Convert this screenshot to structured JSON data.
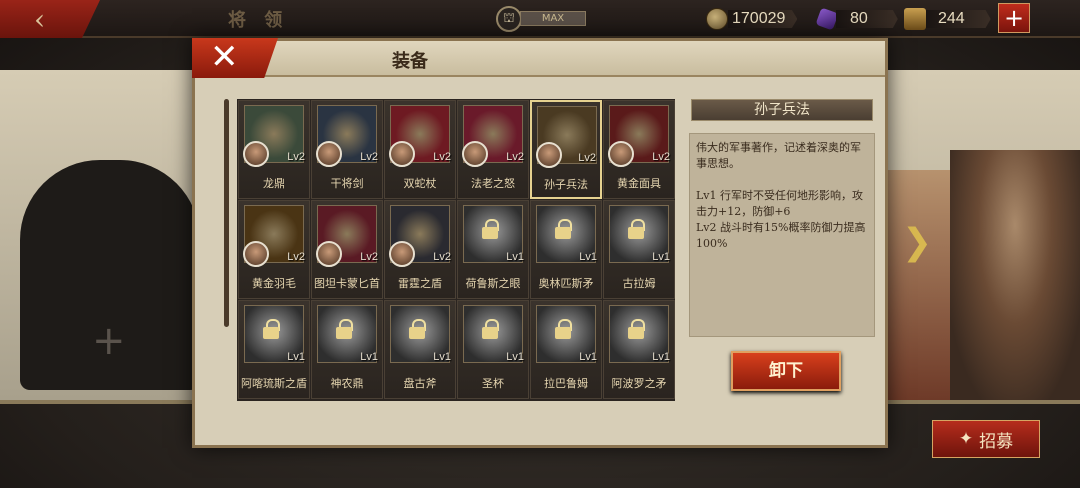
{
  "topbar": {
    "title": "将 领",
    "level_label": "MAX",
    "coins": "170029",
    "gems": "80",
    "chests": "244",
    "plus": "+"
  },
  "recruit_label": "招募",
  "modal": {
    "title": "装备",
    "selected": {
      "name": "孙子兵法",
      "description": "伟大的军事著作，记述着深奥的军事思想。",
      "effect_lv1": "Lv1  行军时不受任何地形影响，攻击力+12，防御+6",
      "effect_lv2": "Lv2  战斗时有15%概率防御力提高100%"
    },
    "unequip_label": "卸下",
    "items": [
      {
        "name": "龙鼎",
        "level": "Lv2",
        "locked": false,
        "color": "#3b4a3a"
      },
      {
        "name": "干将剑",
        "level": "Lv2",
        "locked": false,
        "color": "#2a3442"
      },
      {
        "name": "双蛇杖",
        "level": "Lv2",
        "locked": false,
        "color": "#6e1a22"
      },
      {
        "name": "法老之怒",
        "level": "Lv2",
        "locked": false,
        "color": "#6a1a2a"
      },
      {
        "name": "孙子兵法",
        "level": "Lv2",
        "locked": false,
        "color": "#4a3a22"
      },
      {
        "name": "黄金面具",
        "level": "Lv2",
        "locked": false,
        "color": "#5a1a1a"
      },
      {
        "name": "黄金羽毛",
        "level": "Lv2",
        "locked": false,
        "color": "#4a3414"
      },
      {
        "name": "图坦卡蒙匕首",
        "level": "Lv2",
        "locked": false,
        "color": "#5a1a24"
      },
      {
        "name": "雷霆之盾",
        "level": "Lv2",
        "locked": false,
        "color": "#2a2a30"
      },
      {
        "name": "荷鲁斯之眼",
        "level": "Lv1",
        "locked": true,
        "color": "#555"
      },
      {
        "name": "奥林匹斯矛",
        "level": "Lv1",
        "locked": true,
        "color": "#555"
      },
      {
        "name": "古拉姆",
        "level": "Lv1",
        "locked": true,
        "color": "#555"
      },
      {
        "name": "阿喀琉斯之盾",
        "level": "Lv1",
        "locked": true,
        "color": "#555"
      },
      {
        "name": "神农鼎",
        "level": "Lv1",
        "locked": true,
        "color": "#555"
      },
      {
        "name": "盘古斧",
        "level": "Lv1",
        "locked": true,
        "color": "#555"
      },
      {
        "name": "圣杯",
        "level": "Lv1",
        "locked": true,
        "color": "#555"
      },
      {
        "name": "拉巴鲁姆",
        "level": "Lv1",
        "locked": true,
        "color": "#555"
      },
      {
        "name": "阿波罗之矛",
        "level": "Lv1",
        "locked": true,
        "color": "#555"
      }
    ]
  }
}
